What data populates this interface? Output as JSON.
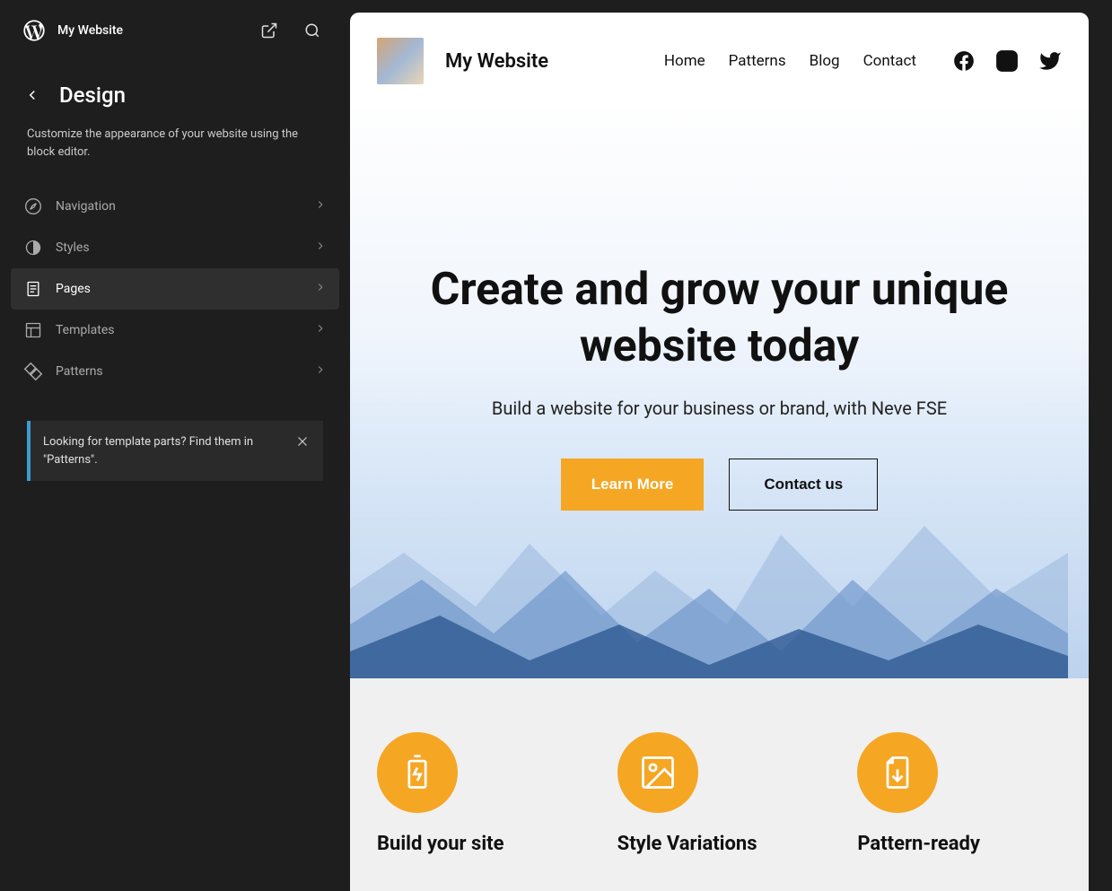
{
  "sidebar": {
    "site_name": "My Website",
    "title": "Design",
    "description": "Customize the appearance of your website using the block editor.",
    "menu": [
      {
        "label": "Navigation",
        "active": false
      },
      {
        "label": "Styles",
        "active": false
      },
      {
        "label": "Pages",
        "active": true
      },
      {
        "label": "Templates",
        "active": false
      },
      {
        "label": "Patterns",
        "active": false
      }
    ],
    "notice": "Looking for template parts? Find them in \"Patterns\"."
  },
  "preview": {
    "site_title": "My Website",
    "nav": [
      "Home",
      "Patterns",
      "Blog",
      "Contact"
    ],
    "hero": {
      "headline": "Create and grow your unique website today",
      "subtext": "Build a website for your business or brand, with Neve FSE",
      "cta_primary": "Learn More",
      "cta_secondary": "Contact us"
    },
    "features": [
      {
        "title": "Build your site"
      },
      {
        "title": "Style Variations"
      },
      {
        "title": "Pattern-ready"
      }
    ]
  }
}
